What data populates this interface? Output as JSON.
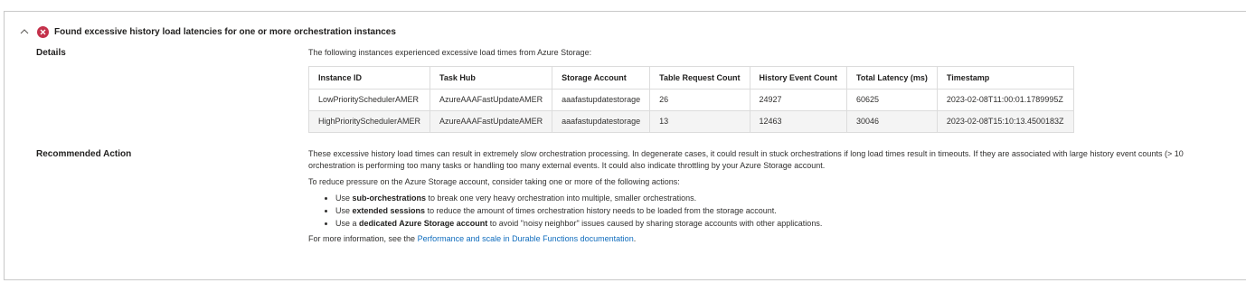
{
  "header": {
    "title": "Found excessive history load latencies for one or more orchestration instances"
  },
  "details": {
    "label": "Details",
    "intro": "The following instances experienced excessive load times from Azure Storage:",
    "columns": [
      "Instance ID",
      "Task Hub",
      "Storage Account",
      "Table Request Count",
      "History Event Count",
      "Total Latency (ms)",
      "Timestamp"
    ],
    "rows": [
      [
        "LowPrioritySchedulerAMER",
        "AzureAAAFastUpdateAMER",
        "aaafastupdatestorage",
        "26",
        "24927",
        "60625",
        "2023-02-08T11:00:01.1789995Z"
      ],
      [
        "HighPrioritySchedulerAMER",
        "AzureAAAFastUpdateAMER",
        "aaafastupdatestorage",
        "13",
        "12463",
        "30046",
        "2023-02-08T15:10:13.4500183Z"
      ]
    ]
  },
  "recommended": {
    "label": "Recommended Action",
    "para1_line1": "These excessive history load times can result in extremely slow orchestration processing. In degenerate cases, it could result in stuck orchestrations if long load times result in timeouts. If they are associated with large history event counts (> 10",
    "para1_line2": "orchestration is performing too many tasks or handling too many external events. It could also indicate throttling by your Azure Storage account.",
    "para2": "To reduce pressure on the Azure Storage account, consider taking one or more of the following actions:",
    "bullets": [
      {
        "pre": "Use ",
        "bold": "sub-orchestrations",
        "post": " to break one very heavy orchestration into multiple, smaller orchestrations."
      },
      {
        "pre": "Use ",
        "bold": "extended sessions",
        "post": " to reduce the amount of times orchestration history needs to be loaded from the storage account."
      },
      {
        "pre": "Use a ",
        "bold": "dedicated Azure Storage account",
        "post": " to avoid \"noisy neighbor\" issues caused by sharing storage accounts with other applications."
      }
    ],
    "more_prefix": "For more information, see the ",
    "more_link": "Performance and scale in Durable Functions documentation",
    "more_suffix": "."
  },
  "colors": {
    "error": "#c4314b",
    "link": "#0f6cbd"
  },
  "icons": [
    "chevron-up-icon",
    "error-circle-icon"
  ]
}
